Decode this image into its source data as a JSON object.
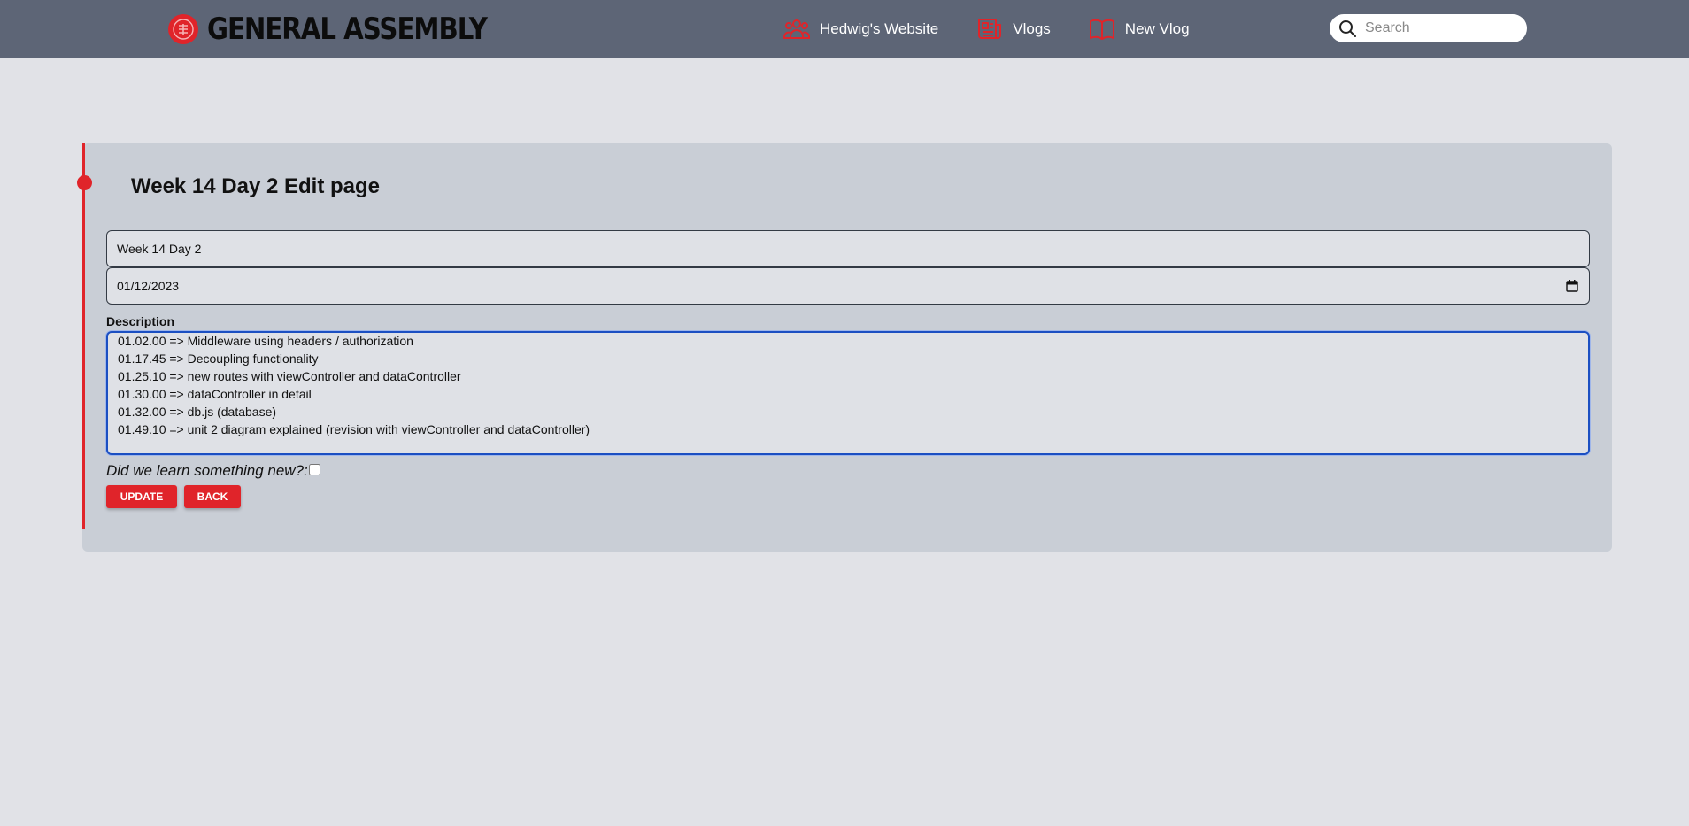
{
  "brand": {
    "name": "GENERAL ASSEMBLY",
    "color": "#e0242a"
  },
  "nav": {
    "items": [
      {
        "label": "Hedwig's Website",
        "icon": "users-icon"
      },
      {
        "label": "Vlogs",
        "icon": "newspaper-icon"
      },
      {
        "label": "New Vlog",
        "icon": "book-open-icon"
      }
    ],
    "search_placeholder": "Search"
  },
  "page": {
    "title": "Week 14 Day 2 Edit page"
  },
  "form": {
    "title_value": "Week 14 Day 2",
    "date_value": "01/12/2023",
    "description_label": "Description",
    "description_lines": [
      "01.02.00 => Middleware using headers / authorization",
      "01.17.45 => Decoupling functionality",
      "01.25.10 => new routes with viewController and dataController",
      "01.30.00 => dataController in detail",
      "01.32.00 => db.js (database)",
      "01.49.10 => unit 2 diagram explained (revision with viewController and dataController)"
    ],
    "learned_label": "Did we learn something new?:",
    "learned_checked": false,
    "update_label": "UPDATE",
    "back_label": "BACK"
  },
  "colors": {
    "navbar": "#5d6576",
    "accent": "#e0242a",
    "card": "#c9ced6",
    "background": "#e1e2e7",
    "focus": "#1b4fc2"
  }
}
